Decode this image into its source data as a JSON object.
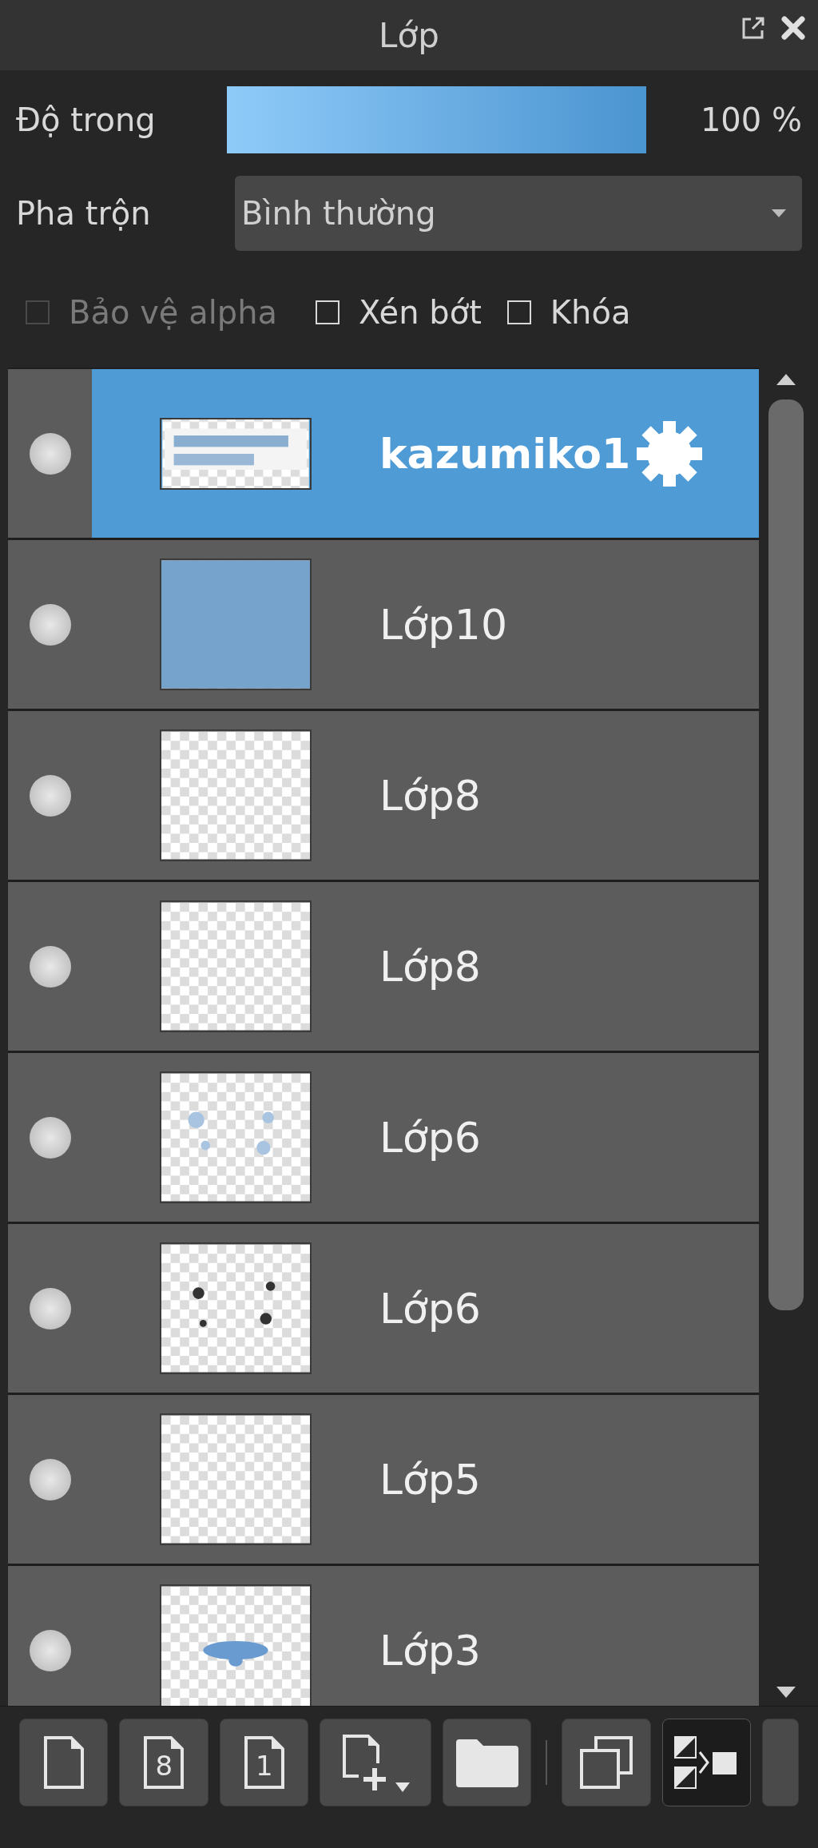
{
  "panel": {
    "title": "Lớp"
  },
  "opacity": {
    "label": "Độ trong",
    "level": 1,
    "reading": "100 %"
  },
  "blend": {
    "label": "Pha trộn",
    "value": "Bình thường"
  },
  "options": [
    {
      "label": "Bảo vệ alpha",
      "checked": false,
      "disabled": true
    },
    {
      "label": "Xén bớt",
      "checked": false,
      "disabled": false
    },
    {
      "label": "Khóa",
      "checked": false,
      "disabled": false
    }
  ],
  "layers": [
    {
      "name": "kazumiko1",
      "selected": true,
      "settings": true
    },
    {
      "name": "Lớp10",
      "selected": false,
      "settings": false
    },
    {
      "name": "Lớp8",
      "selected": false,
      "settings": false
    },
    {
      "name": "Lớp8",
      "selected": false,
      "settings": false
    },
    {
      "name": "Lớp6",
      "selected": false,
      "settings": false
    },
    {
      "name": "Lớp6",
      "selected": false,
      "settings": false
    },
    {
      "name": "Lớp5",
      "selected": false,
      "settings": false
    },
    {
      "name": "Lớp3",
      "selected": false,
      "settings": false
    }
  ],
  "toolbar": [
    {
      "kind": "page",
      "active": false
    },
    {
      "kind": "numbered-page",
      "label": "8",
      "active": false
    },
    {
      "kind": "numbered-page",
      "label": "1",
      "active": false
    },
    {
      "kind": "add-page",
      "active": false
    },
    {
      "kind": "folder",
      "active": false
    },
    {
      "kind": "separator"
    },
    {
      "kind": "duplicate",
      "active": false
    },
    {
      "kind": "merge",
      "active": true
    },
    {
      "kind": "blank",
      "active": false
    }
  ]
}
